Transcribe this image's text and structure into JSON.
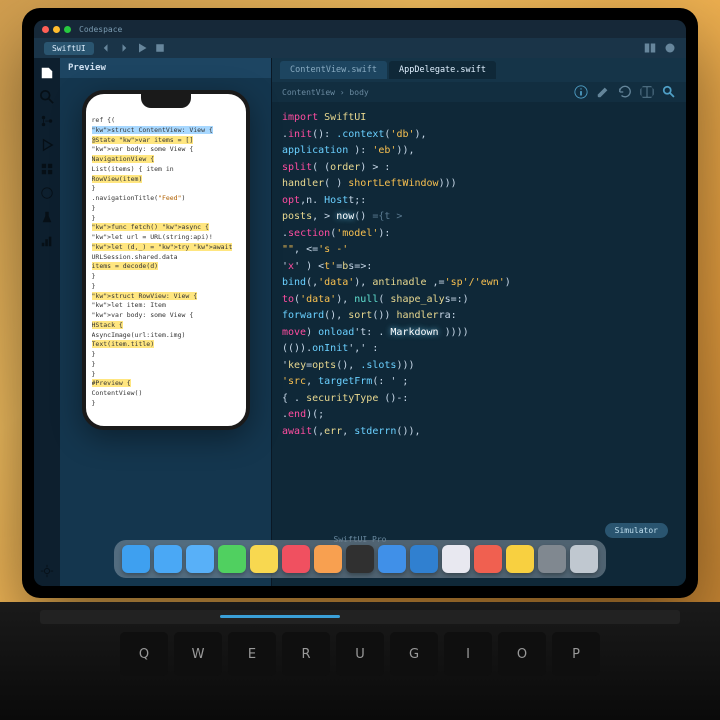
{
  "menubar": {
    "title": "Codespace"
  },
  "toolbar": {
    "project": "SwiftUI",
    "icons": [
      "back",
      "forward",
      "play",
      "stop",
      "split",
      "debug",
      "build"
    ]
  },
  "activity": [
    "files",
    "search",
    "git",
    "debug",
    "extensions",
    "run",
    "test",
    "profile",
    "settings"
  ],
  "left_pane": {
    "title": "Preview"
  },
  "phone_code": [
    {
      "t": "ref {(",
      "c": "kw"
    },
    {
      "t": "struct ContentView: View {",
      "c": "hlb"
    },
    {
      "t": "  @State var items = []",
      "c": "hly"
    },
    {
      "t": "  var body: some View {",
      "c": ""
    },
    {
      "t": "    NavigationView {",
      "c": "hly"
    },
    {
      "t": "      List(items) { item in",
      "c": ""
    },
    {
      "t": "        RowView(item)",
      "c": "hly"
    },
    {
      "t": "      }",
      "c": ""
    },
    {
      "t": "      .navigationTitle(\"Feed\")",
      "c": ""
    },
    {
      "t": "    }",
      "c": ""
    },
    {
      "t": "  }",
      "c": ""
    },
    {
      "t": "  func fetch() async {",
      "c": "hly"
    },
    {
      "t": "    let url = URL(string:api)!",
      "c": ""
    },
    {
      "t": "    let (d,_) = try await",
      "c": "hly"
    },
    {
      "t": "      URLSession.shared.data",
      "c": ""
    },
    {
      "t": "    items = decode(d)",
      "c": "hly"
    },
    {
      "t": "  }",
      "c": ""
    },
    {
      "t": "}",
      "c": ""
    },
    {
      "t": "",
      "c": ""
    },
    {
      "t": "struct RowView: View {",
      "c": "hly"
    },
    {
      "t": "  let item: Item",
      "c": ""
    },
    {
      "t": "  var body: some View {",
      "c": ""
    },
    {
      "t": "    HStack {",
      "c": "hly"
    },
    {
      "t": "      AsyncImage(url:item.img)",
      "c": ""
    },
    {
      "t": "      Text(item.title)",
      "c": "hly"
    },
    {
      "t": "    }",
      "c": ""
    },
    {
      "t": "  }",
      "c": ""
    },
    {
      "t": "}",
      "c": ""
    },
    {
      "t": "",
      "c": ""
    },
    {
      "t": "#Preview {",
      "c": "hly"
    },
    {
      "t": "  ContentView()",
      "c": ""
    },
    {
      "t": "}",
      "c": ""
    }
  ],
  "tabs": [
    {
      "label": "ContentView.swift",
      "active": false
    },
    {
      "label": "AppDelegate.swift",
      "active": true
    }
  ],
  "breadcrumb": "ContentView › body",
  "tool_icons": [
    "info",
    "edit",
    "refresh",
    "split",
    "search"
  ],
  "editor_lines": [
    [
      {
        "t": "import ",
        "c": "ekw"
      },
      {
        "t": "SwiftUI",
        "c": "eid"
      }
    ],
    [
      {
        "t": ".",
        "c": ""
      },
      {
        "t": "init",
        "c": "ekw"
      },
      {
        "t": "(): ",
        "c": ""
      },
      {
        "t": ".context",
        "c": "efn"
      },
      {
        "t": "(",
        "c": ""
      },
      {
        "t": "'db'",
        "c": "estr"
      },
      {
        "t": "),",
        "c": ""
      }
    ],
    [
      {
        "t": "  ",
        "c": ""
      },
      {
        "t": "application",
        "c": "efn"
      },
      {
        "t": "  ): ",
        "c": ""
      },
      {
        "t": "'eb'",
        "c": "estr"
      },
      {
        "t": ")),",
        "c": ""
      }
    ],
    [
      {
        "t": "  ",
        "c": ""
      },
      {
        "t": "split",
        "c": "ekw"
      },
      {
        "t": "( (",
        "c": ""
      },
      {
        "t": "order",
        "c": "eid"
      },
      {
        "t": ") > :",
        "c": ""
      }
    ],
    [
      {
        "t": "  ",
        "c": ""
      },
      {
        "t": "handler",
        "c": "eid"
      },
      {
        "t": "( )  ",
        "c": ""
      },
      {
        "t": "shortLeftWindow",
        "c": "estr"
      },
      {
        "t": ")))",
        "c": ""
      }
    ],
    [
      {
        "t": "  ",
        "c": ""
      },
      {
        "t": "opt",
        "c": "ekw"
      },
      {
        "t": ",n. ",
        "c": ""
      },
      {
        "t": "Host",
        "c": "efn"
      },
      {
        "t": "t;:",
        "c": ""
      }
    ],
    [
      {
        "t": "      ",
        "c": ""
      },
      {
        "t": "posts",
        "c": "eid"
      },
      {
        "t": ", > ",
        "c": ""
      },
      {
        "t": "now",
        "c": "ehi"
      },
      {
        "t": "()  ",
        "c": ""
      },
      {
        "t": "={",
        "c": "ecm"
      },
      {
        "t": "t >",
        "c": "ecm"
      }
    ],
    [
      {
        "t": ".",
        "c": ""
      },
      {
        "t": "section",
        "c": "ekw"
      },
      {
        "t": "(",
        "c": ""
      },
      {
        "t": "'model'",
        "c": "estr"
      },
      {
        "t": "):",
        "c": ""
      }
    ],
    [
      {
        "t": "  ",
        "c": ""
      },
      {
        "t": "\"\"",
        "c": "estr"
      },
      {
        "t": ",      <=",
        "c": ""
      },
      {
        "t": "'s -'",
        "c": "estr"
      }
    ],
    [
      {
        "t": "  '",
        "c": ""
      },
      {
        "t": "x",
        "c": "ekw"
      },
      {
        "t": "'  )    <",
        "c": ""
      },
      {
        "t": "t'",
        "c": "estr"
      },
      {
        "t": "=",
        "c": ""
      },
      {
        "t": "b",
        "c": "eid"
      },
      {
        "t": "s=>:",
        "c": ""
      }
    ],
    [
      {
        "t": "    ",
        "c": ""
      },
      {
        "t": "bind",
        "c": "efn"
      },
      {
        "t": "(,",
        "c": ""
      },
      {
        "t": "'data'",
        "c": "estr"
      },
      {
        "t": "), ",
        "c": ""
      },
      {
        "t": "antinadle",
        "c": "eid"
      },
      {
        "t": " ,=",
        "c": ""
      },
      {
        "t": "'sp'/'ewn'",
        "c": "estr"
      },
      {
        "t": ")",
        "c": ""
      }
    ],
    [
      {
        "t": "    ",
        "c": ""
      },
      {
        "t": "to",
        "c": "ekw"
      },
      {
        "t": "(",
        "c": ""
      },
      {
        "t": "'data'",
        "c": "estr"
      },
      {
        "t": "),  ",
        "c": ""
      },
      {
        "t": "null",
        "c": "elit"
      },
      {
        "t": "( ",
        "c": ""
      },
      {
        "t": "shape_aly",
        "c": "eid"
      },
      {
        "t": "s=:)",
        "c": ""
      }
    ],
    [
      {
        "t": "    ",
        "c": ""
      },
      {
        "t": "forward",
        "c": "efn"
      },
      {
        "t": "(), ",
        "c": ""
      },
      {
        "t": "sort",
        "c": "eid"
      },
      {
        "t": "())      ",
        "c": ""
      },
      {
        "t": "handler",
        "c": "eid"
      },
      {
        "t": "ra:",
        "c": ""
      }
    ],
    [
      {
        "t": "    ",
        "c": ""
      },
      {
        "t": "move",
        "c": "ekw"
      },
      {
        "t": ")   ",
        "c": ""
      },
      {
        "t": "onload",
        "c": "efn"
      },
      {
        "t": "'t:      . ",
        "c": ""
      },
      {
        "t": "Markdown",
        "c": "ehi"
      },
      {
        "t": " ))))",
        "c": ""
      }
    ],
    [
      {
        "t": "    (())",
        "c": ""
      },
      {
        "t": ".",
        "c": ""
      },
      {
        "t": "onInit",
        "c": "efn"
      },
      {
        "t": "','  :",
        "c": ""
      }
    ],
    [
      {
        "t": "        '",
        "c": ""
      },
      {
        "t": "key",
        "c": "eid"
      },
      {
        "t": "=",
        "c": ""
      },
      {
        "t": "opts",
        "c": "eid"
      },
      {
        "t": "(), ",
        "c": ""
      },
      {
        "t": ".slots",
        "c": "efn"
      },
      {
        "t": ")))",
        "c": ""
      }
    ],
    [
      {
        "t": "      ",
        "c": ""
      },
      {
        "t": "'src",
        "c": "estr"
      },
      {
        "t": ", ",
        "c": ""
      },
      {
        "t": "targetFrm",
        "c": "efn"
      },
      {
        "t": "(: ' ;",
        "c": ""
      }
    ],
    [
      {
        "t": "      ",
        "c": ""
      },
      {
        "t": "{",
        "c": ""
      },
      {
        "t": " . ",
        "c": ""
      },
      {
        "t": "securityType",
        "c": "eid"
      },
      {
        "t": " ()-:",
        "c": ""
      }
    ],
    [
      {
        "t": "  .",
        "c": ""
      },
      {
        "t": "end",
        "c": "ekw"
      },
      {
        "t": ")(;",
        "c": ""
      }
    ],
    [
      {
        "t": "    ",
        "c": ""
      },
      {
        "t": "await",
        "c": "ekw"
      },
      {
        "t": "(,",
        "c": ""
      },
      {
        "t": "err",
        "c": "eid"
      },
      {
        "t": ", ",
        "c": ""
      },
      {
        "t": "stderrn",
        "c": "efn"
      },
      {
        "t": "()),",
        "c": ""
      }
    ]
  ],
  "pill": "Simulator",
  "footer": "SwiftUI Pro",
  "dock": [
    {
      "name": "finder",
      "color": "#3ea0f0"
    },
    {
      "name": "safari",
      "color": "#4aa8f5"
    },
    {
      "name": "mail",
      "color": "#58b0f8"
    },
    {
      "name": "messages",
      "color": "#50d060"
    },
    {
      "name": "notes",
      "color": "#f8d850"
    },
    {
      "name": "music",
      "color": "#f05060"
    },
    {
      "name": "photos",
      "color": "#f8a050"
    },
    {
      "name": "terminal",
      "color": "#303030"
    },
    {
      "name": "xcode",
      "color": "#4090e8"
    },
    {
      "name": "vscode",
      "color": "#3080d0"
    },
    {
      "name": "slack",
      "color": "#e8e8f0"
    },
    {
      "name": "figma",
      "color": "#f06050"
    },
    {
      "name": "chrome",
      "color": "#f8d040"
    },
    {
      "name": "system",
      "color": "#808890"
    },
    {
      "name": "trash",
      "color": "#c0c8d0"
    }
  ],
  "keys": [
    "Q",
    "W",
    "E",
    "R",
    "U",
    "G",
    "I",
    "O",
    "P"
  ]
}
